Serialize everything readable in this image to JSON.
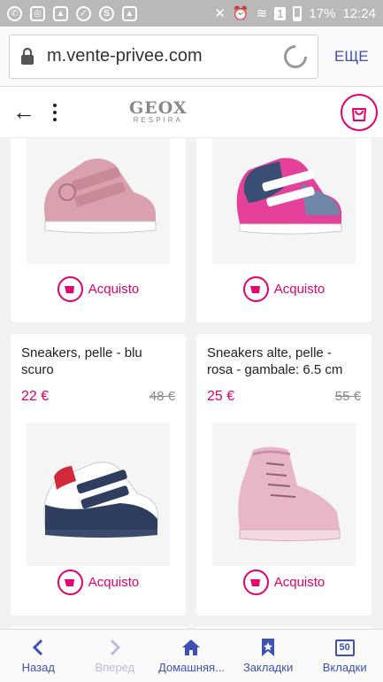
{
  "status_bar": {
    "battery": "17%",
    "time": "12:24",
    "sim": "1"
  },
  "browser": {
    "url": "m.vente-privee.com",
    "menu_label": "ЕЩЕ"
  },
  "site": {
    "logo_main": "GEOX",
    "logo_sub": "RESPIRA"
  },
  "products": [
    {
      "name": "",
      "price": "",
      "old_price": "",
      "buy_label": "Acquisto",
      "color": "pink-velcro"
    },
    {
      "name": "",
      "price": "",
      "old_price": "",
      "buy_label": "Acquisto",
      "color": "pink-navy"
    },
    {
      "name": "Sneakers, pelle - blu scuro",
      "price": "22 €",
      "old_price": "48 €",
      "buy_label": "Acquisto",
      "color": "navy-white"
    },
    {
      "name": "Sneakers alte, pelle - rosa - gambale: 6.5 cm",
      "price": "25 €",
      "old_price": "55 €",
      "buy_label": "Acquisto",
      "color": "light-pink"
    }
  ],
  "bottom_nav": [
    {
      "label": "Назад",
      "icon": "chevron-left-icon"
    },
    {
      "label": "Вперед",
      "icon": "chevron-right-icon"
    },
    {
      "label": "Домашняя...",
      "icon": "home-icon"
    },
    {
      "label": "Закладки",
      "icon": "bookmark-icon"
    },
    {
      "label": "Вкладки",
      "icon": "tabs-icon",
      "count": "50"
    }
  ],
  "colors": {
    "accent": "#e5006d",
    "browser_blue": "#3f51b5"
  }
}
